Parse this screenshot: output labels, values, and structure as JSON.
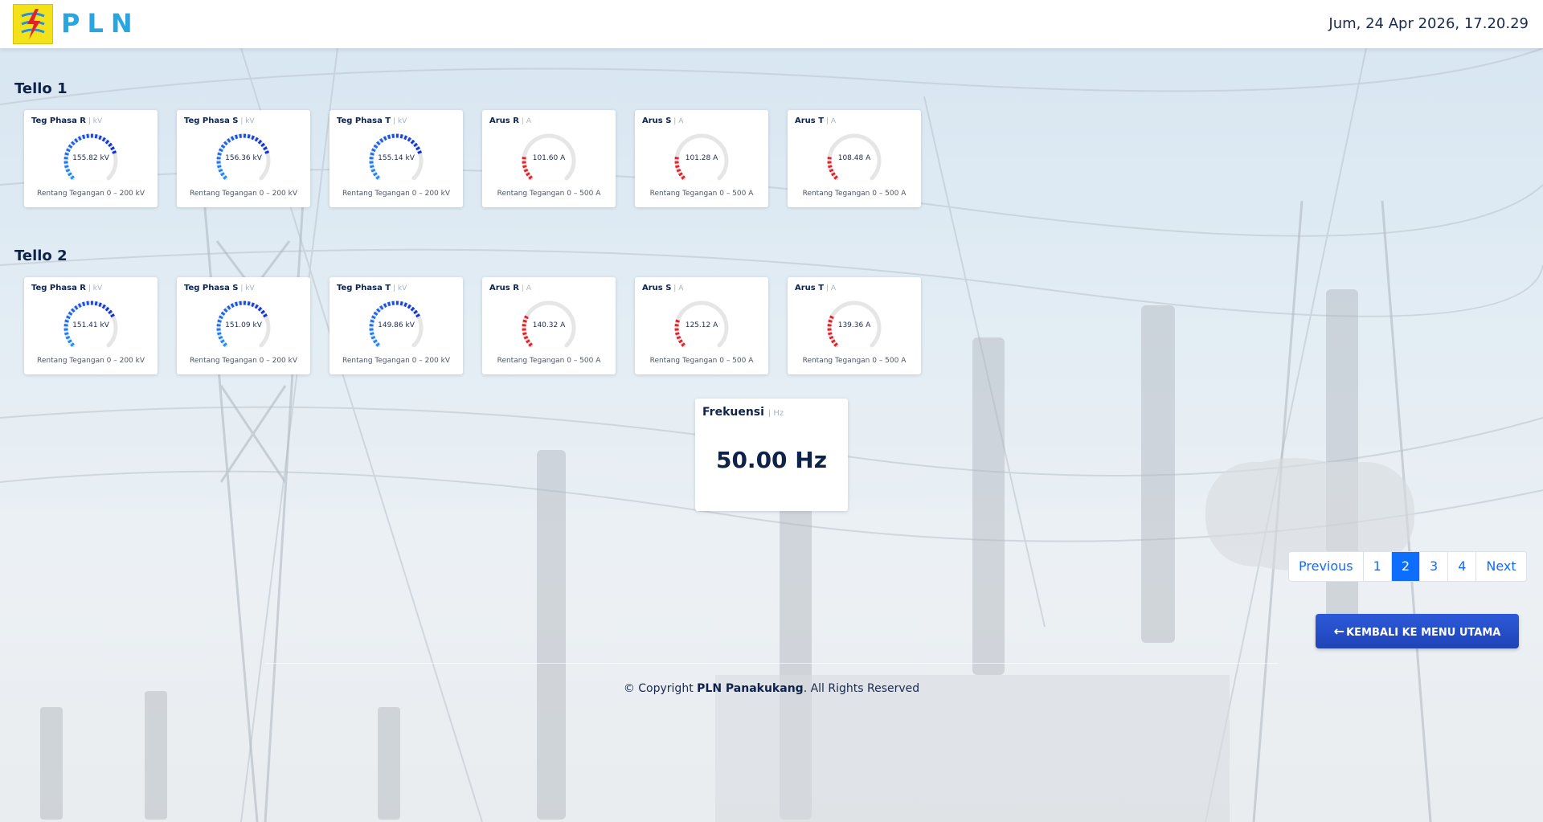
{
  "header": {
    "brand": "PLN",
    "datetime": "Jum, 24 Apr 2026, 17.20.29",
    "logo_color": "#f3e21a",
    "brand_color": "#29a6de"
  },
  "colors": {
    "voltage_gauge": "#0057ff",
    "current_gauge": "#e8202a",
    "gauge_track": "#e6e6e6",
    "button": "#2451cf",
    "active_page": "#0d6efd"
  },
  "sections": [
    {
      "title": "Tello 1",
      "gauges": [
        {
          "title": "Teg Phasa R",
          "unit": "kV",
          "value": 155.82,
          "value_label": "155.82 kV",
          "range_label": "Rentang Tegangan 0 – 200 kV",
          "max": 200,
          "kind": "voltage"
        },
        {
          "title": "Teg Phasa S",
          "unit": "kV",
          "value": 156.36,
          "value_label": "156.36 kV",
          "range_label": "Rentang Tegangan 0 – 200 kV",
          "max": 200,
          "kind": "voltage"
        },
        {
          "title": "Teg Phasa T",
          "unit": "kV",
          "value": 155.14,
          "value_label": "155.14 kV",
          "range_label": "Rentang Tegangan 0 – 200 kV",
          "max": 200,
          "kind": "voltage"
        },
        {
          "title": "Arus R",
          "unit": "A",
          "value": 101.6,
          "value_label": "101.60 A",
          "range_label": "Rentang Tegangan 0 – 500 A",
          "max": 500,
          "kind": "current"
        },
        {
          "title": "Arus S",
          "unit": "A",
          "value": 101.28,
          "value_label": "101.28 A",
          "range_label": "Rentang Tegangan 0 – 500 A",
          "max": 500,
          "kind": "current"
        },
        {
          "title": "Arus T",
          "unit": "A",
          "value": 108.48,
          "value_label": "108.48 A",
          "range_label": "Rentang Tegangan 0 – 500 A",
          "max": 500,
          "kind": "current"
        }
      ]
    },
    {
      "title": "Tello 2",
      "gauges": [
        {
          "title": "Teg Phasa R",
          "unit": "kV",
          "value": 151.41,
          "value_label": "151.41 kV",
          "range_label": "Rentang Tegangan 0 – 200 kV",
          "max": 200,
          "kind": "voltage"
        },
        {
          "title": "Teg Phasa S",
          "unit": "kV",
          "value": 151.09,
          "value_label": "151.09 kV",
          "range_label": "Rentang Tegangan 0 – 200 kV",
          "max": 200,
          "kind": "voltage"
        },
        {
          "title": "Teg Phasa T",
          "unit": "kV",
          "value": 149.86,
          "value_label": "149.86 kV",
          "range_label": "Rentang Tegangan 0 – 200 kV",
          "max": 200,
          "kind": "voltage"
        },
        {
          "title": "Arus R",
          "unit": "A",
          "value": 140.32,
          "value_label": "140.32 A",
          "range_label": "Rentang Tegangan 0 – 500 A",
          "max": 500,
          "kind": "current"
        },
        {
          "title": "Arus S",
          "unit": "A",
          "value": 125.12,
          "value_label": "125.12 A",
          "range_label": "Rentang Tegangan 0 – 500 A",
          "max": 500,
          "kind": "current"
        },
        {
          "title": "Arus T",
          "unit": "A",
          "value": 139.36,
          "value_label": "139.36 A",
          "range_label": "Rentang Tegangan 0 – 500 A",
          "max": 500,
          "kind": "current"
        }
      ]
    }
  ],
  "frequency": {
    "title": "Frekuensi",
    "unit": "Hz",
    "value_label": "50.00 Hz"
  },
  "pagination": {
    "items": [
      "Previous",
      "1",
      "2",
      "3",
      "4",
      "Next"
    ],
    "active": "2"
  },
  "back_button": {
    "icon": "arrow-left-icon",
    "label": "KEMBALI KE MENU UTAMA"
  },
  "footer": {
    "prefix": "© Copyright ",
    "company": "PLN Panakukang",
    "suffix": ". All Rights Reserved"
  }
}
